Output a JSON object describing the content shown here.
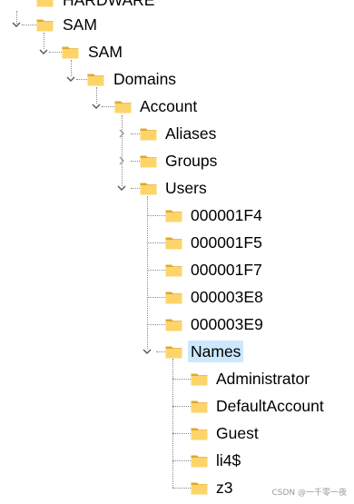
{
  "tree": {
    "nodes": [
      {
        "label": "HARDWARE",
        "state": "collapsed",
        "selected": false
      },
      {
        "label": "SAM",
        "state": "expanded",
        "selected": false
      },
      {
        "label": "SAM",
        "state": "expanded",
        "selected": false
      },
      {
        "label": "Domains",
        "state": "expanded",
        "selected": false
      },
      {
        "label": "Account",
        "state": "expanded",
        "selected": false
      },
      {
        "label": "Aliases",
        "state": "collapsed",
        "selected": false
      },
      {
        "label": "Groups",
        "state": "collapsed",
        "selected": false
      },
      {
        "label": "Users",
        "state": "expanded",
        "selected": false
      },
      {
        "label": "000001F4",
        "state": "leaf",
        "selected": false
      },
      {
        "label": "000001F5",
        "state": "leaf",
        "selected": false
      },
      {
        "label": "000001F7",
        "state": "leaf",
        "selected": false
      },
      {
        "label": "000003E8",
        "state": "leaf",
        "selected": false
      },
      {
        "label": "000003E9",
        "state": "leaf",
        "selected": false
      },
      {
        "label": "Names",
        "state": "expanded",
        "selected": true
      },
      {
        "label": "Administrator",
        "state": "leaf",
        "selected": false
      },
      {
        "label": "DefaultAccount",
        "state": "leaf",
        "selected": false
      },
      {
        "label": "Guest",
        "state": "leaf",
        "selected": false
      },
      {
        "label": "li4$",
        "state": "leaf",
        "selected": false
      },
      {
        "label": "z3",
        "state": "leaf",
        "selected": false
      }
    ]
  },
  "icons": {
    "folder": "folder-icon",
    "expanded": "chevron-down-icon",
    "collapsed": "chevron-right-icon"
  },
  "colors": {
    "selection": "#cce8ff",
    "folder_fill": "#fcd46a",
    "folder_edge": "#e2a82a",
    "tree_line": "#8a8a8a",
    "chevron": "#555555"
  },
  "watermark": "CSDN @一千零一夜"
}
